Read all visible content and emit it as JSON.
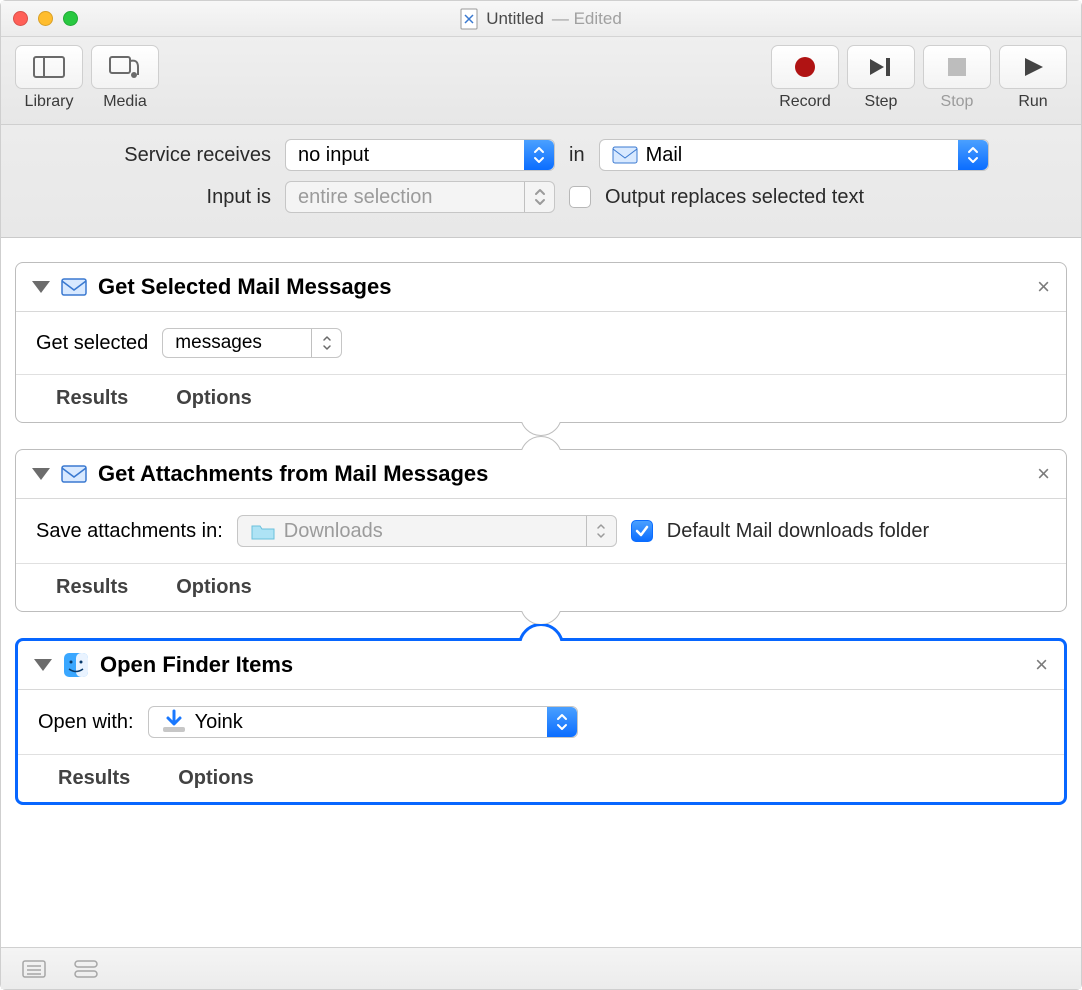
{
  "window": {
    "title": "Untitled",
    "status": "Edited"
  },
  "toolbar": {
    "library": "Library",
    "media": "Media",
    "record": "Record",
    "step": "Step",
    "stop": "Stop",
    "run": "Run"
  },
  "header": {
    "service_receives_label": "Service receives",
    "service_receives_value": "no input",
    "in_label": "in",
    "app_value": "Mail",
    "input_is_label": "Input is",
    "input_is_value": "entire selection",
    "output_replaces_checked": false,
    "output_replaces_label": "Output replaces selected text"
  },
  "actions": [
    {
      "icon": "mail-app-icon",
      "title": "Get Selected Mail Messages",
      "fields": {
        "label": "Get selected",
        "select_value": "messages"
      },
      "footer": {
        "results": "Results",
        "options": "Options"
      },
      "selected": false
    },
    {
      "icon": "mail-app-icon",
      "title": "Get Attachments from Mail Messages",
      "fields": {
        "label": "Save attachments in:",
        "folder_value": "Downloads",
        "checkbox_checked": true,
        "checkbox_label": "Default Mail downloads folder"
      },
      "footer": {
        "results": "Results",
        "options": "Options"
      },
      "selected": false
    },
    {
      "icon": "finder-app-icon",
      "title": "Open Finder Items",
      "fields": {
        "label": "Open with:",
        "app_value": "Yoink"
      },
      "footer": {
        "results": "Results",
        "options": "Options"
      },
      "selected": true
    }
  ]
}
